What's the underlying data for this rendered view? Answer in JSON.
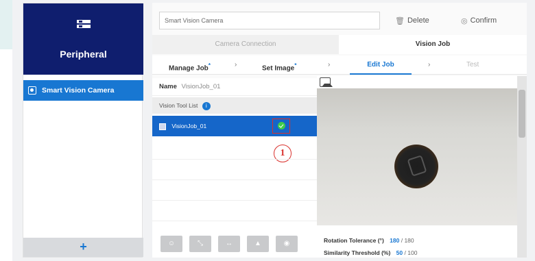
{
  "sidebar": {
    "title": "Peripheral",
    "items": [
      {
        "label": "Smart Vision Camera"
      }
    ],
    "add_label": "+"
  },
  "header": {
    "device_name": "Smart Vision Camera",
    "delete_label": "Delete",
    "confirm_label": "Confirm"
  },
  "tabs": [
    {
      "label": "Camera Connection"
    },
    {
      "label": "Vision Job"
    }
  ],
  "steps": [
    {
      "label": "Manage Job"
    },
    {
      "label": "Set Image"
    },
    {
      "label": "Edit Job"
    },
    {
      "label": "Test"
    }
  ],
  "job": {
    "name_label": "Name",
    "name_value": "VisionJob_01",
    "tool_list_label": "Vision Tool List",
    "tools": [
      {
        "label": "VisionJob_01",
        "status": "ok"
      }
    ]
  },
  "annotation": {
    "marker": "1"
  },
  "params": {
    "rotation_label": "Rotation Tolerance (°)",
    "rotation_value": "180",
    "rotation_max": "/ 180",
    "similarity_label": "Similarity Threshold (%)",
    "similarity_value": "50",
    "similarity_max": "/ 100"
  },
  "colors": {
    "sidebar_header": "#0f1e6e",
    "accent": "#1877d2",
    "selected_row": "#1566c9",
    "status_ok": "#3dcc4a",
    "annotation": "#d9302c"
  }
}
